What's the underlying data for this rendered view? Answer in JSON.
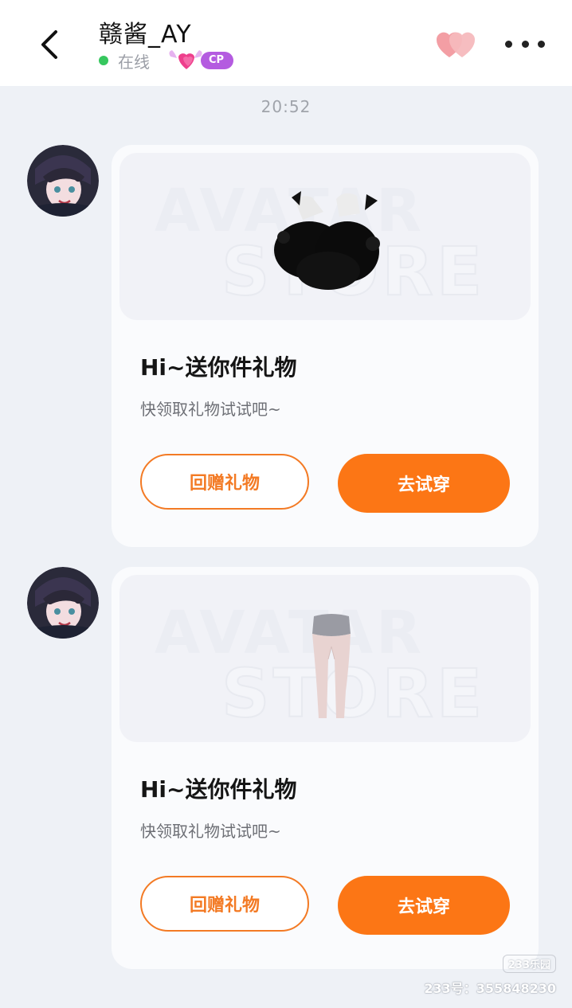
{
  "header": {
    "title": "赣酱_AY",
    "status": "在线",
    "cp_badge": "CP"
  },
  "timestamp": "20:52",
  "messages": [
    {
      "gift_title": "Hi~送你件礼物",
      "gift_subtitle": "快领取礼物试试吧~",
      "return_label": "回赠礼物",
      "try_label": "去试穿",
      "watermark_line1": "AVATAR",
      "watermark_line2": "STORE",
      "item_icon": "fluffy-shoes-icon"
    },
    {
      "gift_title": "Hi~送你件礼物",
      "gift_subtitle": "快领取礼物试试吧~",
      "return_label": "回赠礼物",
      "try_label": "去试穿",
      "watermark_line1": "AVATAR",
      "watermark_line2": "STORE",
      "item_icon": "tights-icon"
    }
  ],
  "footer_watermark": {
    "logo": "233乐园",
    "id_text": "233号：355848230"
  },
  "colors": {
    "accent": "#fc7615",
    "cp_badge": "#b45be0",
    "online": "#36c75e",
    "background": "#eef1f6"
  }
}
